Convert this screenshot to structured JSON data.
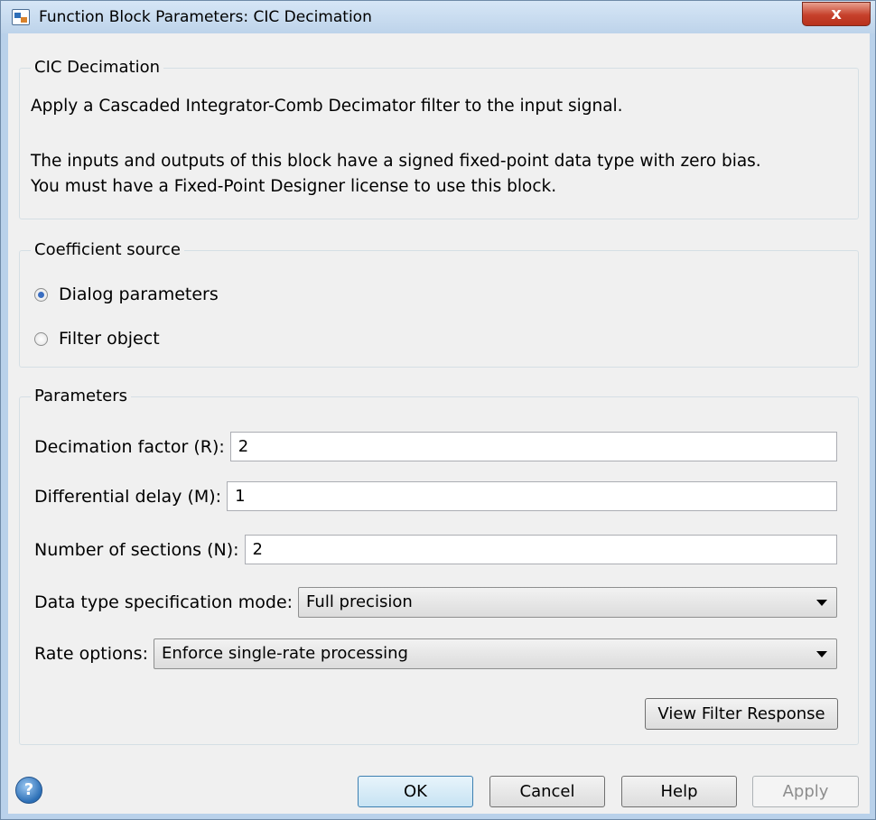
{
  "window": {
    "title": "Function Block Parameters: CIC Decimation",
    "close_glyph": "x"
  },
  "description": {
    "legend": "CIC Decimation",
    "line1": "Apply a Cascaded Integrator-Comb Decimator filter to the input signal.",
    "line2": "The inputs and outputs of this block have a signed fixed-point data type with zero bias.",
    "line3": "You must have a Fixed-Point Designer license to use this block."
  },
  "coefficient_source": {
    "legend": "Coefficient source",
    "options": [
      {
        "label": "Dialog parameters",
        "selected": true
      },
      {
        "label": "Filter object",
        "selected": false
      }
    ]
  },
  "parameters": {
    "legend": "Parameters",
    "decimation_factor": {
      "label": "Decimation factor (R):",
      "value": "2"
    },
    "differential_delay": {
      "label": "Differential delay (M):",
      "value": "1"
    },
    "number_of_sections": {
      "label": "Number of sections (N):",
      "value": "2"
    },
    "data_type_mode": {
      "label": "Data type specification mode:",
      "value": "Full precision"
    },
    "rate_options": {
      "label": "Rate options:",
      "value": "Enforce single-rate processing"
    },
    "view_filter_response": "View Filter Response"
  },
  "buttons": {
    "ok": "OK",
    "cancel": "Cancel",
    "help": "Help",
    "apply": "Apply",
    "help_icon_glyph": "?"
  },
  "colors": {
    "frame": "#b9d1ea",
    "client": "#f0f0f0",
    "close_button": "#c6402b",
    "default_button_border": "#3c7fb1"
  }
}
